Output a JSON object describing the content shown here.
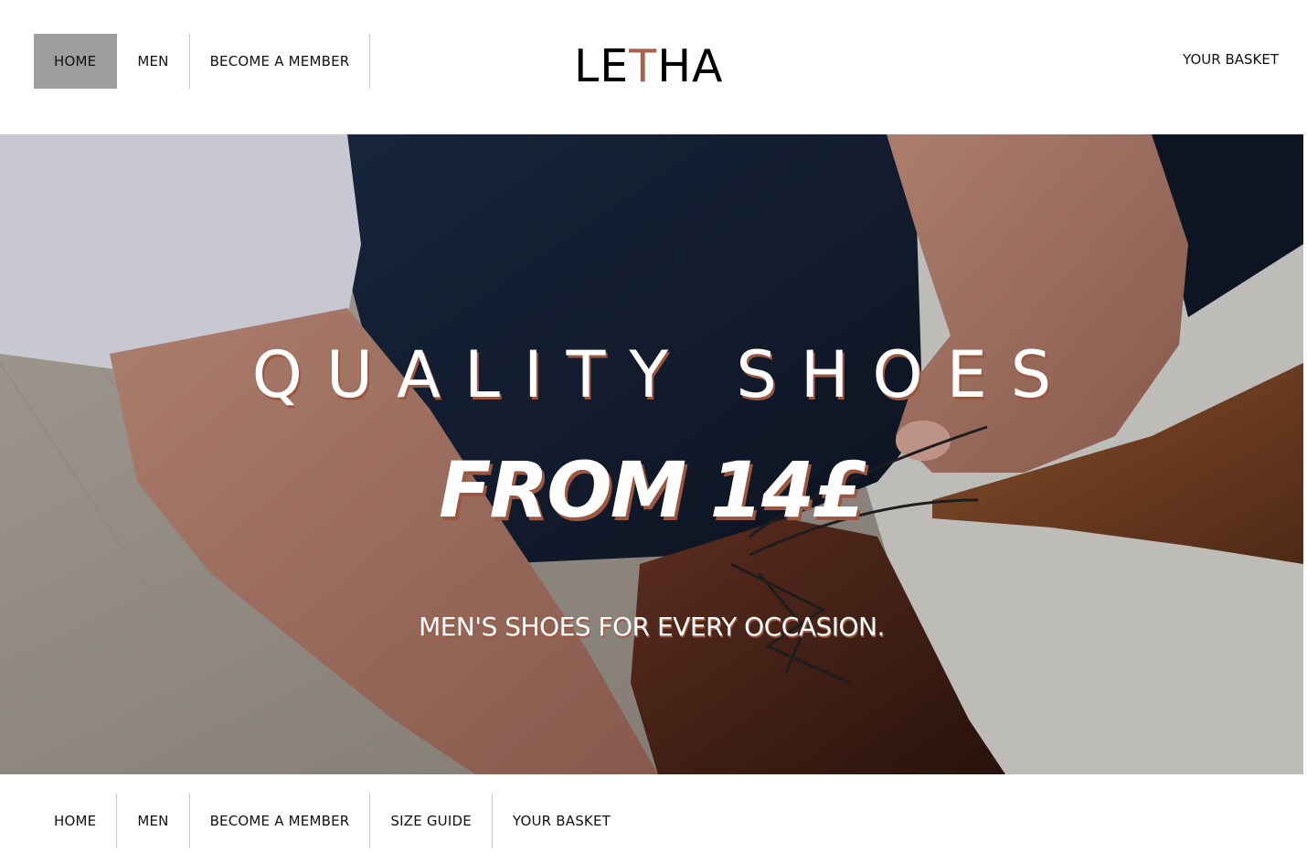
{
  "brand": {
    "logo_part1": "LE",
    "logo_accent": "T",
    "logo_part2": "HA",
    "accent_color": "#a9614a"
  },
  "top_nav": {
    "items": [
      {
        "label": "HOME",
        "active": true
      },
      {
        "label": "MEN",
        "active": false
      },
      {
        "label": "BECOME A MEMBER",
        "active": false
      }
    ],
    "basket_label": "YOUR BASKET",
    "active_bg": "#9e9e9e"
  },
  "hero": {
    "title": "QUALITY SHOES",
    "price": "FROM 14£",
    "subtitle": "MEN'S SHOES FOR EVERY OCCASION.",
    "image_icon": "man-tying-shoe-photo"
  },
  "bottom_nav": {
    "items": [
      {
        "label": "HOME"
      },
      {
        "label": "MEN"
      },
      {
        "label": "BECOME A MEMBER"
      },
      {
        "label": "SIZE GUIDE"
      },
      {
        "label": "YOUR BASKET"
      }
    ]
  }
}
